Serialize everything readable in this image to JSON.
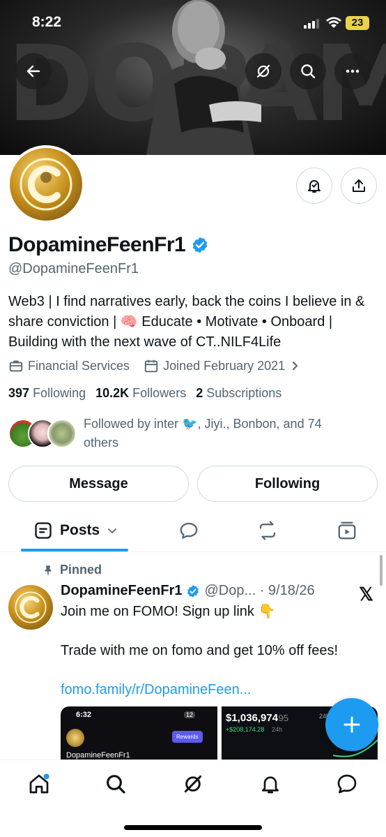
{
  "status": {
    "time": "8:22",
    "battery": "23"
  },
  "banner": {
    "text": "DOPAMINEFEEN"
  },
  "profile": {
    "name": "DopamineFeenFr1",
    "handle": "@DopamineFeenFr1",
    "bio": "Web3 | I find narratives early, back the coins I believe in & share conviction | 🧠 Educate • Motivate • Onboard | Building with the next wave of CT..NILF4Life",
    "category": "Financial Services",
    "joined": "Joined February 2021",
    "following_count": "397",
    "following_label": "Following",
    "followers_count": "10.2K",
    "followers_label": "Followers",
    "subscriptions_count": "2",
    "subscriptions_label": "Subscriptions",
    "followed_by": "Followed by inter 🐦, Jiyi., Bonbon, and 74 others"
  },
  "actions": {
    "message": "Message",
    "following": "Following"
  },
  "tabs": {
    "posts": "Posts"
  },
  "post": {
    "pinned_label": "Pinned",
    "author": "DopamineFeenFr1",
    "meta": "@Dop... · 9/18/26",
    "line1": "Join me on FOMO! Sign up link 👇",
    "line2": "Trade with me on fomo and get 10% off fees!",
    "link": "fomo.family/r/DopamineFeen...",
    "media1": {
      "time": "6:32",
      "badge": "12",
      "rewards": "Rewards",
      "name": "DopamineFeenFr1"
    },
    "media2": {
      "value": "$1,036,974",
      "cents": ".95",
      "change": "+$208,174.28",
      "period": "24h",
      "period2": "24h"
    }
  },
  "colors": {
    "accent": "#1d9bf0",
    "text": "#0f1419",
    "muted": "#536471"
  }
}
